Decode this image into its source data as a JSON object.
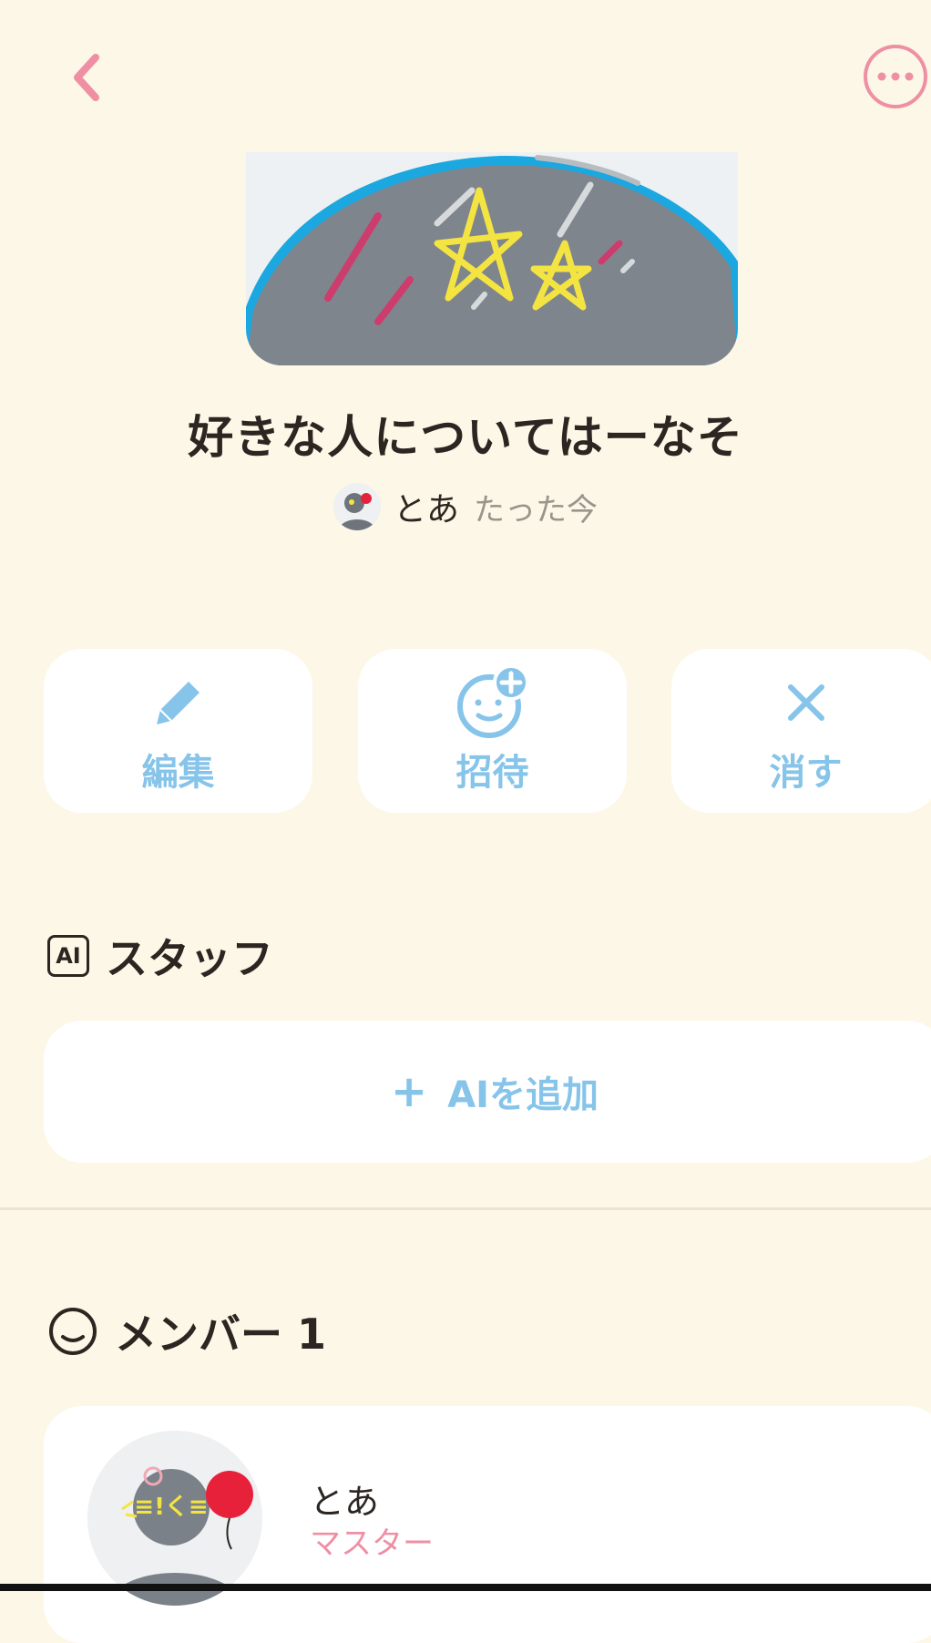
{
  "room": {
    "title": "好きな人についてはーなそ",
    "owner_name": "とあ",
    "updated": "たった今"
  },
  "actions": [
    {
      "label": "編集",
      "icon": "pencil-icon"
    },
    {
      "label": "招待",
      "icon": "invite-face-plus-icon"
    },
    {
      "label": "消す",
      "icon": "close-icon"
    }
  ],
  "staff": {
    "heading": "スタッフ",
    "badge": "AI",
    "add_button": "AIを追加"
  },
  "members": {
    "heading": "メンバー 1",
    "list": [
      {
        "name": "とあ",
        "role": "マスター"
      }
    ]
  },
  "colors": {
    "background": "#fdf7e7",
    "accent_pink": "#ef8fa3",
    "accent_blue": "#86c4ea",
    "card": "#ffffff"
  },
  "icons": {
    "back": "chevron-left-icon",
    "more": "more-horizontal-icon"
  }
}
